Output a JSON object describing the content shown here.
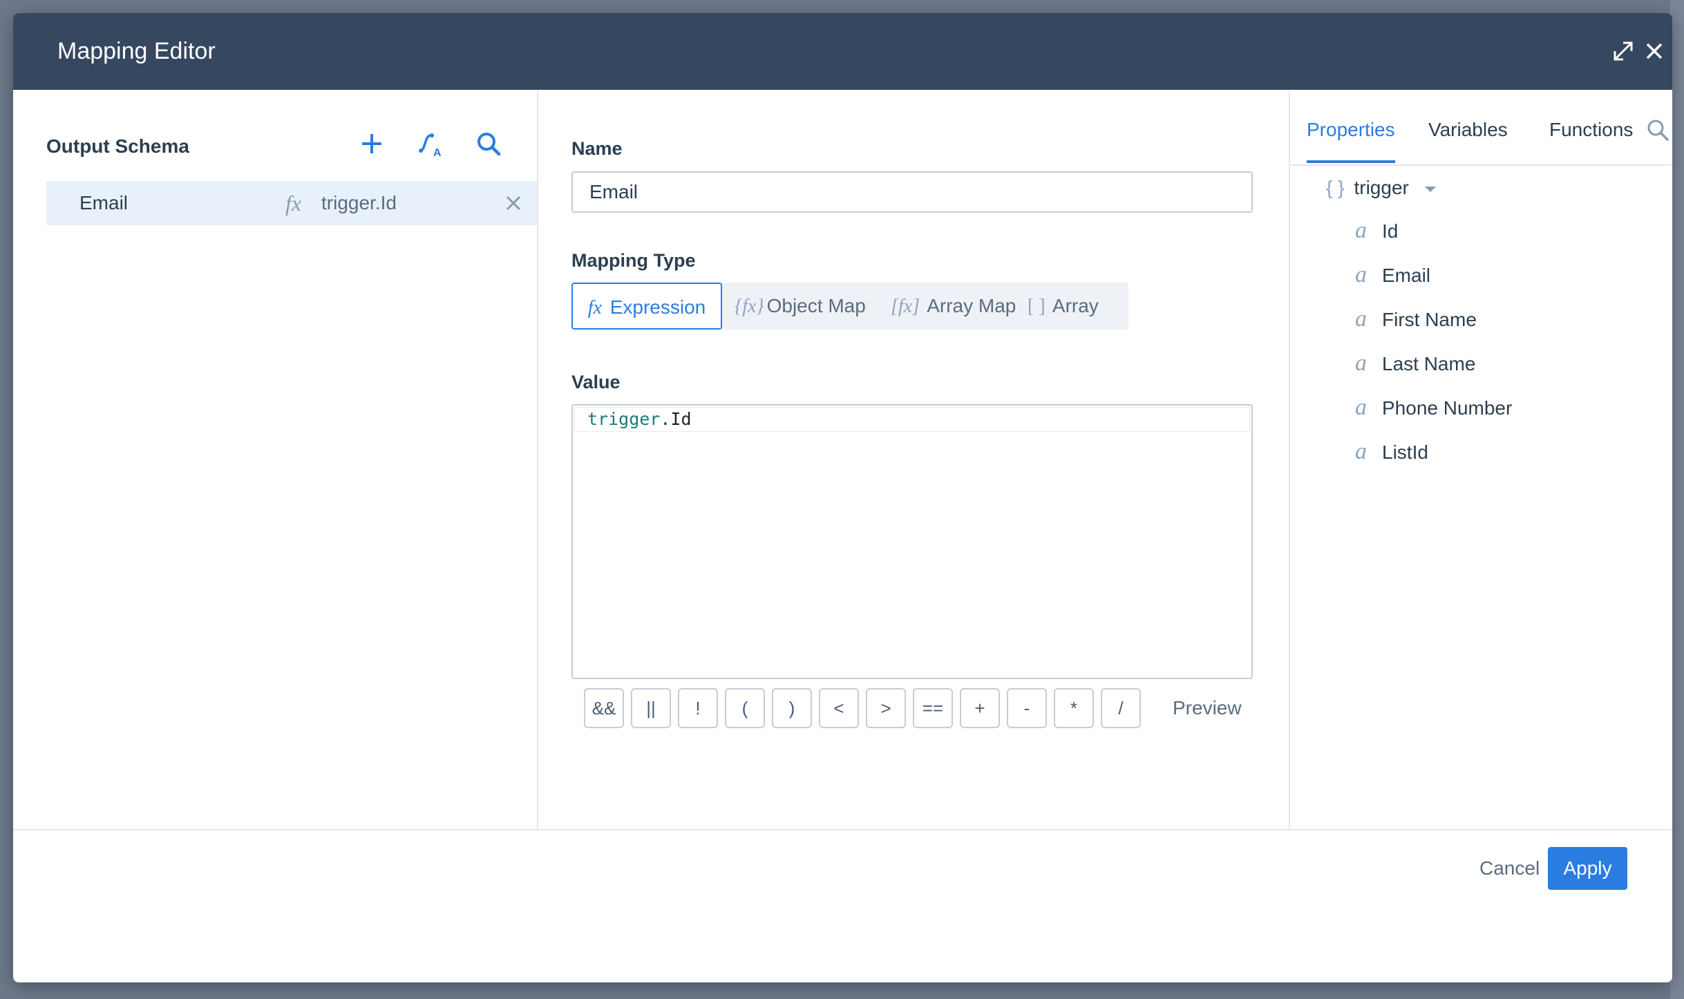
{
  "modal": {
    "title": "Mapping Editor"
  },
  "output_schema": {
    "title": "Output Schema",
    "rows": [
      {
        "name": "Email",
        "expression": "trigger.Id"
      }
    ]
  },
  "editor": {
    "name_label": "Name",
    "name_value": "Email",
    "mapping_type_label": "Mapping Type",
    "mapping_types": [
      {
        "icon_text": "fx",
        "label": "Expression",
        "active": true
      },
      {
        "icon_text": "{fx}",
        "label": "Object Map",
        "active": false
      },
      {
        "icon_text": "[fx]",
        "label": "Array Map",
        "active": false
      },
      {
        "icon_text": "[ ]",
        "label": "Array",
        "active": false
      }
    ],
    "value_label": "Value",
    "value_tokens": {
      "object": "trigger",
      "dot": ".",
      "property": "Id"
    },
    "operators": [
      "&&",
      "||",
      "!",
      "(",
      ")",
      "<",
      ">",
      "==",
      "+",
      "-",
      "*",
      "/"
    ],
    "preview_label": "Preview"
  },
  "right_panel": {
    "tabs": [
      "Properties",
      "Variables",
      "Functions"
    ],
    "active_tab": "Properties",
    "tree_root": {
      "icon_text": "{ }",
      "label": "trigger"
    },
    "tree_items": [
      {
        "icon_text": "a",
        "label": "Id"
      },
      {
        "icon_text": "a",
        "label": "Email"
      },
      {
        "icon_text": "a",
        "label": "First Name"
      },
      {
        "icon_text": "a",
        "label": "Last Name"
      },
      {
        "icon_text": "a",
        "label": "Phone Number"
      },
      {
        "icon_text": "a",
        "label": "ListId"
      }
    ]
  },
  "footer": {
    "cancel_label": "Cancel",
    "apply_label": "Apply"
  },
  "colors": {
    "header": "#364760",
    "accent": "#2a7de1",
    "selected_row": "#e8f1fb"
  }
}
